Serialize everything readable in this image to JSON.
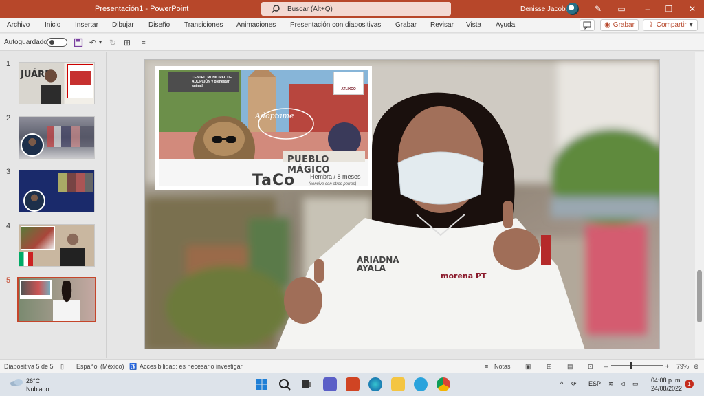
{
  "window": {
    "title": "Presentación1 - PowerPoint",
    "search_placeholder": "Buscar (Alt+Q)",
    "user": "Denisse Jacobo"
  },
  "menu": {
    "items": [
      "Archivo",
      "Inicio",
      "Insertar",
      "Dibujar",
      "Diseño",
      "Transiciones",
      "Animaciones",
      "Presentación con diapositivas",
      "Grabar",
      "Revisar",
      "Vista",
      "Ayuda"
    ],
    "record_label": "Grabar",
    "share_label": "Compartir"
  },
  "qat": {
    "autosave_label": "Autoguardado"
  },
  "slides": {
    "numbers": [
      "1",
      "2",
      "3",
      "4",
      "5"
    ],
    "active": "5"
  },
  "slide5": {
    "adoption_org": "CENTRO MUNICIPAL DE ADOPCIÓN y bienestar animal",
    "badge": "ATLIXCO",
    "adoptame": "Adóptame",
    "pueblo": "PUEBLO MÁGICO",
    "pet_name": "TaCo",
    "pet_info": "Hembra / 8 meses",
    "pet_note": "(convive con otros perros)",
    "shirt_name": "ARIADNA AYALA",
    "shirt_party": "morena PT"
  },
  "statusbar": {
    "slide_info": "Diapositiva 5 de 5",
    "language": "Español (México)",
    "accessibility": "Accesibilidad: es necesario investigar",
    "notes": "Notas",
    "zoom": "79%"
  },
  "taskbar": {
    "temperature": "26°C",
    "weather": "Nublado",
    "lang": "ESP",
    "time": "04:08 p. m.",
    "date": "24/08/2022",
    "notifications": "1"
  },
  "colors": {
    "accent": "#b7472a",
    "party": "#8a1a2c"
  }
}
